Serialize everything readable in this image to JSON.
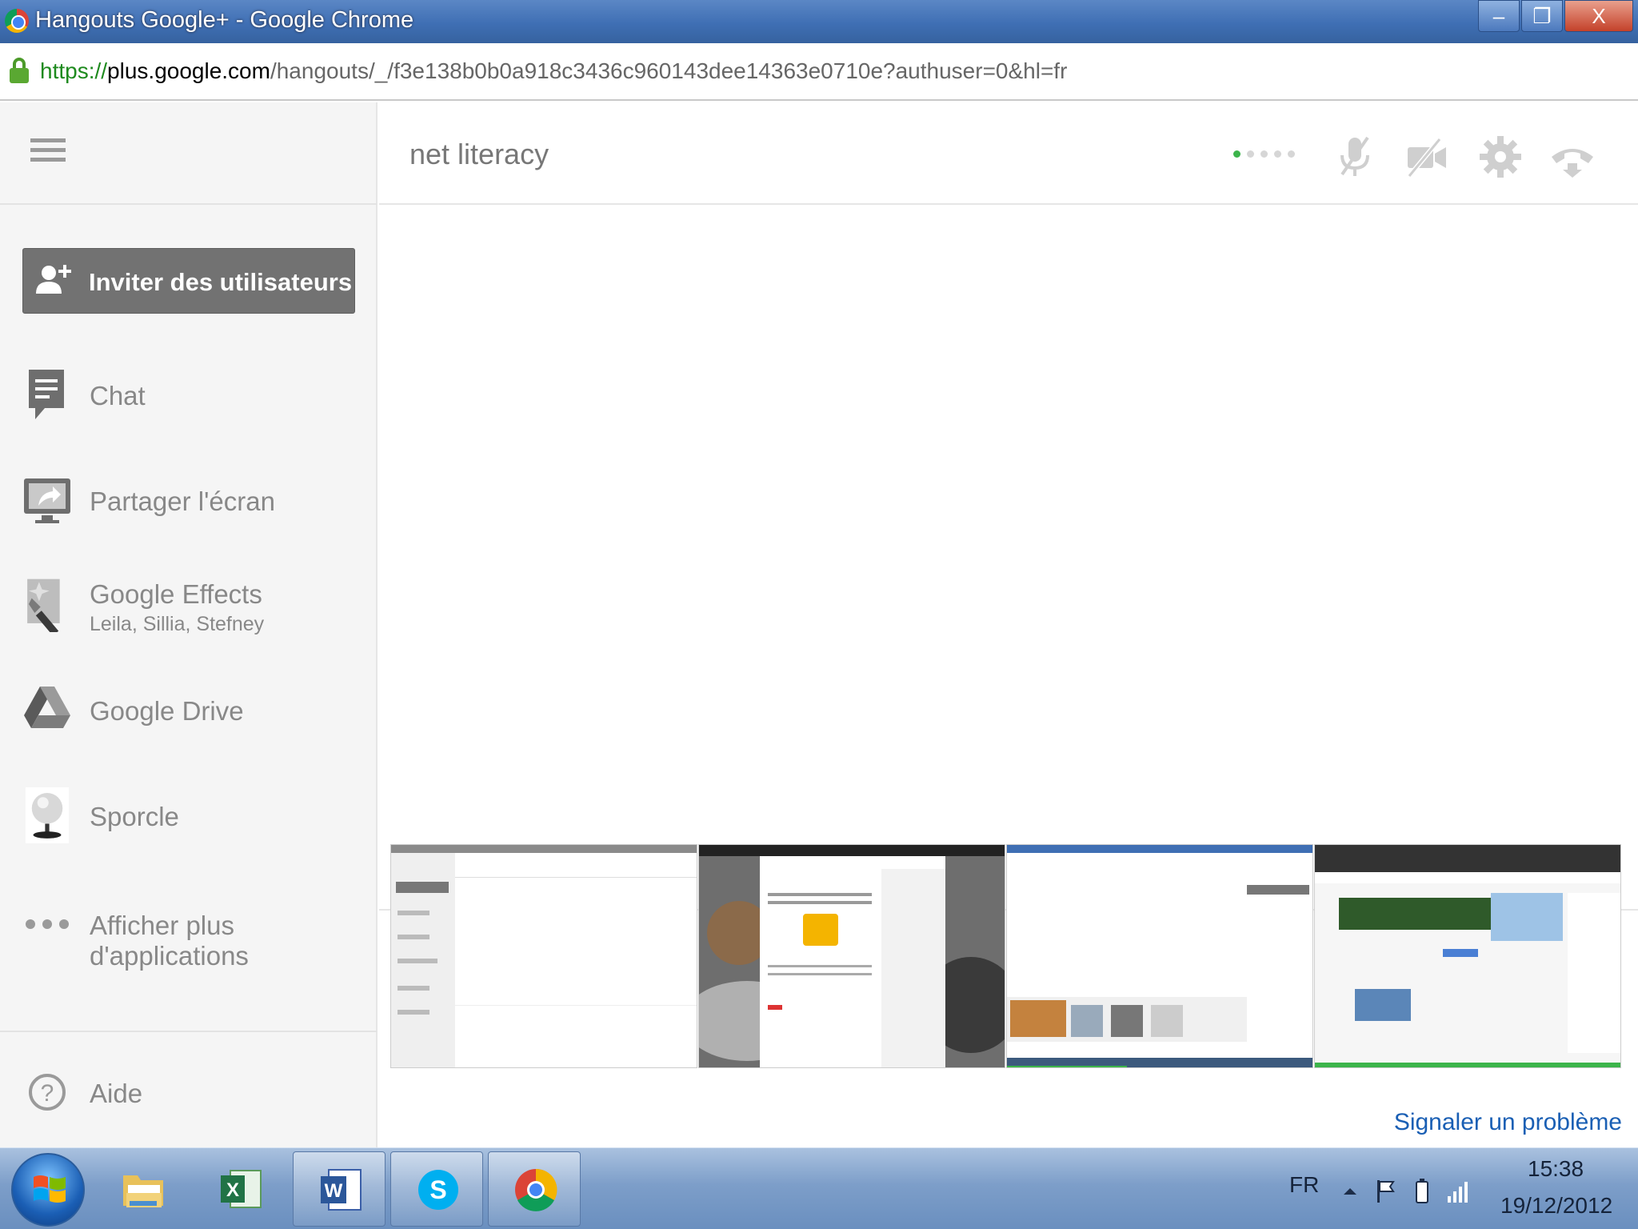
{
  "window": {
    "title": "Hangouts Google+ - Google Chrome",
    "buttons": {
      "minimize": "–",
      "maximize": "❐",
      "close": "X"
    }
  },
  "address_bar": {
    "scheme": "https://",
    "host": "plus.google.com",
    "path": "/hangouts/_/f3e138b0b0a918c3436c960143dee14363e0710e?authuser=0&hl=fr"
  },
  "sidebar": {
    "invite_label": "Inviter des utilisateurs",
    "apps": [
      {
        "name": "Chat",
        "icon": "chat-icon"
      },
      {
        "name": "Partager l'écran",
        "icon": "screenshare-icon"
      },
      {
        "name": "Google Effects",
        "subtitle": "Leila, Sillia, Stefney",
        "icon": "effects-wand-icon"
      },
      {
        "name": "Google Drive",
        "icon": "drive-icon"
      },
      {
        "name": "Sporcle",
        "icon": "globe-icon"
      },
      {
        "name": "Afficher plus d'applications",
        "icon": "more-dots-icon"
      }
    ],
    "help_label": "Aide"
  },
  "main": {
    "call_title": "net literacy",
    "signal_bars_lit": 1,
    "signal_bars_total": 5,
    "controls": [
      "mic-muted-icon",
      "camera-off-icon",
      "settings-gear-icon",
      "hang-up-icon"
    ],
    "filmstrip_count": 4,
    "report_link": "Signaler un problème"
  },
  "taskbar": {
    "apps": [
      "windows-explorer",
      "microsoft-excel",
      "microsoft-word",
      "skype",
      "google-chrome"
    ],
    "language": "FR",
    "time": "15:38",
    "date": "19/12/2012"
  },
  "colors": {
    "title_bar": "#3f6fb4",
    "sidebar_bg": "#f5f5f5",
    "invite_button": "#727272",
    "link": "#1a5fb4",
    "signal_on": "#3cb44b"
  }
}
